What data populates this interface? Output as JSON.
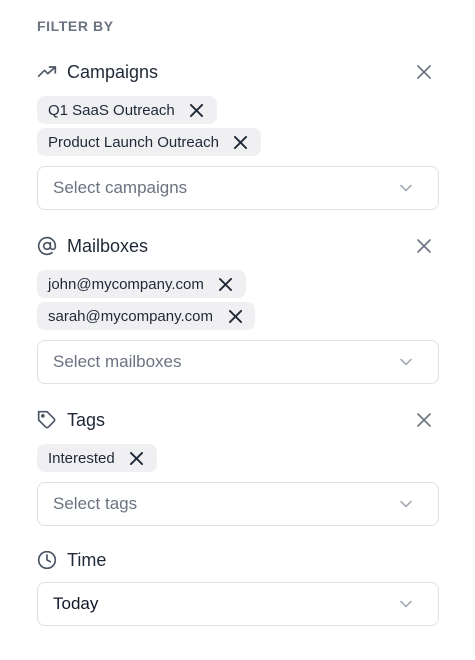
{
  "filter": {
    "heading": "FILTER BY",
    "campaigns": {
      "title": "Campaigns",
      "icon": "trending-up-icon",
      "chips": [
        "Q1 SaaS Outreach",
        "Product Launch Outreach"
      ],
      "placeholder": "Select campaigns"
    },
    "mailboxes": {
      "title": "Mailboxes",
      "icon": "at-sign-icon",
      "chips": [
        "john@mycompany.com",
        "sarah@mycompany.com"
      ],
      "placeholder": "Select mailboxes"
    },
    "tags": {
      "title": "Tags",
      "icon": "tag-icon",
      "chips": [
        "Interested"
      ],
      "placeholder": "Select tags"
    },
    "time": {
      "title": "Time",
      "icon": "clock-icon",
      "value": "Today"
    }
  }
}
